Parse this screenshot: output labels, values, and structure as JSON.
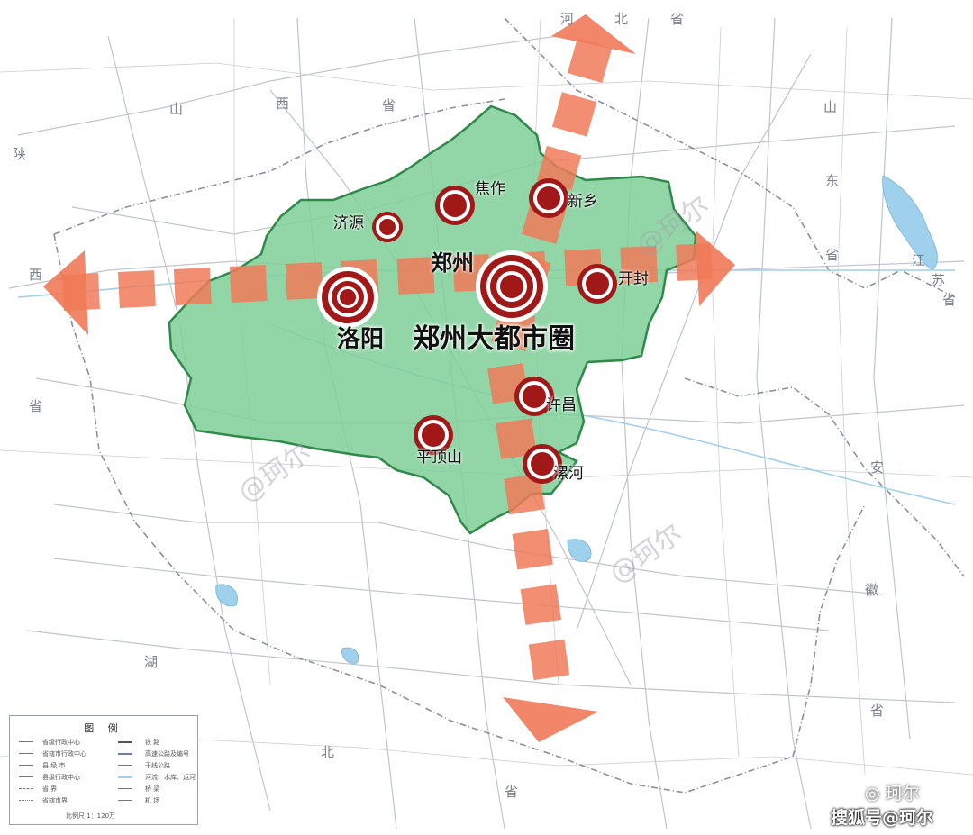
{
  "map": {
    "title": "郑州大都市圈",
    "core_city": "郑州",
    "cities": [
      {
        "id": "luoyang",
        "name": "洛阳"
      },
      {
        "id": "jiaozuo",
        "name": "焦作"
      },
      {
        "id": "xinxiang",
        "name": "新乡"
      },
      {
        "id": "jiyuan",
        "name": "济源"
      },
      {
        "id": "kaifeng",
        "name": "开封"
      },
      {
        "id": "xuchang",
        "name": "许昌"
      },
      {
        "id": "pingdingshan",
        "name": "平顶山"
      },
      {
        "id": "luohe",
        "name": "漯河"
      }
    ],
    "provinces": [
      {
        "id": "hebei-he",
        "name": "河"
      },
      {
        "id": "hebei-bei",
        "name": "北"
      },
      {
        "id": "hebei-sheng",
        "name": "省"
      },
      {
        "id": "shanxi-shan",
        "name": "山"
      },
      {
        "id": "shanxi-xi",
        "name": "西"
      },
      {
        "id": "shanxi-sheng",
        "name": "省"
      },
      {
        "id": "shaanxi-shan",
        "name": "陕"
      },
      {
        "id": "shaanxi-xi",
        "name": "西"
      },
      {
        "id": "shaanxi-sheng",
        "name": "省"
      },
      {
        "id": "shandong-shan",
        "name": "山"
      },
      {
        "id": "shandong-dong",
        "name": "东"
      },
      {
        "id": "shandong-sheng",
        "name": "省"
      },
      {
        "id": "jiangsu-jiang",
        "name": "江"
      },
      {
        "id": "jiangsu-su",
        "name": "苏"
      },
      {
        "id": "jiangsu-sheng",
        "name": "省"
      },
      {
        "id": "anhui-an",
        "name": "安"
      },
      {
        "id": "anhui-hui",
        "name": "徽"
      },
      {
        "id": "anhui-sheng",
        "name": "省"
      },
      {
        "id": "hubei-hu",
        "name": "湖"
      },
      {
        "id": "hubei-bei",
        "name": "北"
      },
      {
        "id": "hubei-sheng",
        "name": "省"
      }
    ],
    "watermark": "@珂尔",
    "colors": {
      "region_fill": "#7fcf98",
      "region_border": "#2f8a4a",
      "axis": "#f07a58",
      "city_dot": "#a01818",
      "road": "#b9bfc9",
      "river": "#9fd0ec"
    }
  },
  "legend": {
    "title": "图  例",
    "items": [
      "省级行政中心",
      "省辖市行政中心",
      "县 级 市",
      "县级行政中心",
      "省 界",
      "省辖市界"
    ],
    "items_right": [
      "铁 路",
      "高速公路及编号",
      "干线公路",
      "河流、水库、运河",
      "桥 梁",
      "机 场"
    ],
    "scale": "比例尺  1：120万"
  },
  "footer": {
    "source": "搜狐号@珂尔",
    "wechat": "珂尔"
  }
}
